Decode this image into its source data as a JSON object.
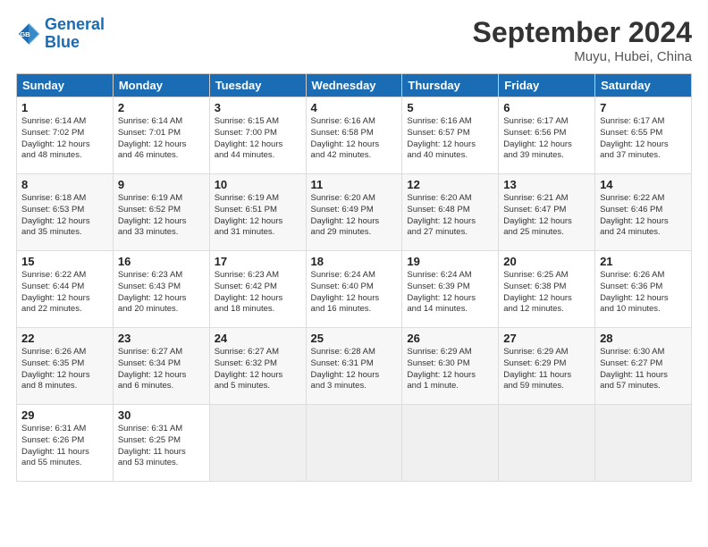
{
  "header": {
    "logo_line1": "General",
    "logo_line2": "Blue",
    "title": "September 2024",
    "location": "Muyu, Hubei, China"
  },
  "days_of_week": [
    "Sunday",
    "Monday",
    "Tuesday",
    "Wednesday",
    "Thursday",
    "Friday",
    "Saturday"
  ],
  "weeks": [
    [
      {
        "day": "1",
        "lines": [
          "Sunrise: 6:14 AM",
          "Sunset: 7:02 PM",
          "Daylight: 12 hours",
          "and 48 minutes."
        ]
      },
      {
        "day": "2",
        "lines": [
          "Sunrise: 6:14 AM",
          "Sunset: 7:01 PM",
          "Daylight: 12 hours",
          "and 46 minutes."
        ]
      },
      {
        "day": "3",
        "lines": [
          "Sunrise: 6:15 AM",
          "Sunset: 7:00 PM",
          "Daylight: 12 hours",
          "and 44 minutes."
        ]
      },
      {
        "day": "4",
        "lines": [
          "Sunrise: 6:16 AM",
          "Sunset: 6:58 PM",
          "Daylight: 12 hours",
          "and 42 minutes."
        ]
      },
      {
        "day": "5",
        "lines": [
          "Sunrise: 6:16 AM",
          "Sunset: 6:57 PM",
          "Daylight: 12 hours",
          "and 40 minutes."
        ]
      },
      {
        "day": "6",
        "lines": [
          "Sunrise: 6:17 AM",
          "Sunset: 6:56 PM",
          "Daylight: 12 hours",
          "and 39 minutes."
        ]
      },
      {
        "day": "7",
        "lines": [
          "Sunrise: 6:17 AM",
          "Sunset: 6:55 PM",
          "Daylight: 12 hours",
          "and 37 minutes."
        ]
      }
    ],
    [
      {
        "day": "8",
        "lines": [
          "Sunrise: 6:18 AM",
          "Sunset: 6:53 PM",
          "Daylight: 12 hours",
          "and 35 minutes."
        ]
      },
      {
        "day": "9",
        "lines": [
          "Sunrise: 6:19 AM",
          "Sunset: 6:52 PM",
          "Daylight: 12 hours",
          "and 33 minutes."
        ]
      },
      {
        "day": "10",
        "lines": [
          "Sunrise: 6:19 AM",
          "Sunset: 6:51 PM",
          "Daylight: 12 hours",
          "and 31 minutes."
        ]
      },
      {
        "day": "11",
        "lines": [
          "Sunrise: 6:20 AM",
          "Sunset: 6:49 PM",
          "Daylight: 12 hours",
          "and 29 minutes."
        ]
      },
      {
        "day": "12",
        "lines": [
          "Sunrise: 6:20 AM",
          "Sunset: 6:48 PM",
          "Daylight: 12 hours",
          "and 27 minutes."
        ]
      },
      {
        "day": "13",
        "lines": [
          "Sunrise: 6:21 AM",
          "Sunset: 6:47 PM",
          "Daylight: 12 hours",
          "and 25 minutes."
        ]
      },
      {
        "day": "14",
        "lines": [
          "Sunrise: 6:22 AM",
          "Sunset: 6:46 PM",
          "Daylight: 12 hours",
          "and 24 minutes."
        ]
      }
    ],
    [
      {
        "day": "15",
        "lines": [
          "Sunrise: 6:22 AM",
          "Sunset: 6:44 PM",
          "Daylight: 12 hours",
          "and 22 minutes."
        ]
      },
      {
        "day": "16",
        "lines": [
          "Sunrise: 6:23 AM",
          "Sunset: 6:43 PM",
          "Daylight: 12 hours",
          "and 20 minutes."
        ]
      },
      {
        "day": "17",
        "lines": [
          "Sunrise: 6:23 AM",
          "Sunset: 6:42 PM",
          "Daylight: 12 hours",
          "and 18 minutes."
        ]
      },
      {
        "day": "18",
        "lines": [
          "Sunrise: 6:24 AM",
          "Sunset: 6:40 PM",
          "Daylight: 12 hours",
          "and 16 minutes."
        ]
      },
      {
        "day": "19",
        "lines": [
          "Sunrise: 6:24 AM",
          "Sunset: 6:39 PM",
          "Daylight: 12 hours",
          "and 14 minutes."
        ]
      },
      {
        "day": "20",
        "lines": [
          "Sunrise: 6:25 AM",
          "Sunset: 6:38 PM",
          "Daylight: 12 hours",
          "and 12 minutes."
        ]
      },
      {
        "day": "21",
        "lines": [
          "Sunrise: 6:26 AM",
          "Sunset: 6:36 PM",
          "Daylight: 12 hours",
          "and 10 minutes."
        ]
      }
    ],
    [
      {
        "day": "22",
        "lines": [
          "Sunrise: 6:26 AM",
          "Sunset: 6:35 PM",
          "Daylight: 12 hours",
          "and 8 minutes."
        ]
      },
      {
        "day": "23",
        "lines": [
          "Sunrise: 6:27 AM",
          "Sunset: 6:34 PM",
          "Daylight: 12 hours",
          "and 6 minutes."
        ]
      },
      {
        "day": "24",
        "lines": [
          "Sunrise: 6:27 AM",
          "Sunset: 6:32 PM",
          "Daylight: 12 hours",
          "and 5 minutes."
        ]
      },
      {
        "day": "25",
        "lines": [
          "Sunrise: 6:28 AM",
          "Sunset: 6:31 PM",
          "Daylight: 12 hours",
          "and 3 minutes."
        ]
      },
      {
        "day": "26",
        "lines": [
          "Sunrise: 6:29 AM",
          "Sunset: 6:30 PM",
          "Daylight: 12 hours",
          "and 1 minute."
        ]
      },
      {
        "day": "27",
        "lines": [
          "Sunrise: 6:29 AM",
          "Sunset: 6:29 PM",
          "Daylight: 11 hours",
          "and 59 minutes."
        ]
      },
      {
        "day": "28",
        "lines": [
          "Sunrise: 6:30 AM",
          "Sunset: 6:27 PM",
          "Daylight: 11 hours",
          "and 57 minutes."
        ]
      }
    ],
    [
      {
        "day": "29",
        "lines": [
          "Sunrise: 6:31 AM",
          "Sunset: 6:26 PM",
          "Daylight: 11 hours",
          "and 55 minutes."
        ]
      },
      {
        "day": "30",
        "lines": [
          "Sunrise: 6:31 AM",
          "Sunset: 6:25 PM",
          "Daylight: 11 hours",
          "and 53 minutes."
        ]
      },
      {
        "day": "",
        "lines": []
      },
      {
        "day": "",
        "lines": []
      },
      {
        "day": "",
        "lines": []
      },
      {
        "day": "",
        "lines": []
      },
      {
        "day": "",
        "lines": []
      }
    ]
  ]
}
